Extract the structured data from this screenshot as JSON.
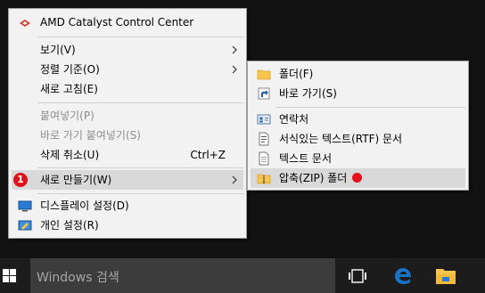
{
  "context_menu": {
    "amd": "AMD Catalyst Control Center",
    "view": "보기(V)",
    "sort": "정렬 기준(O)",
    "refresh": "새로 고침(E)",
    "paste": "붙여넣기(P)",
    "paste_shortcut": "바로 가기 붙여넣기(S)",
    "undo": "삭제 취소(U)",
    "undo_key": "Ctrl+Z",
    "new": "새로 만들기(W)",
    "new_badge": "1",
    "display": "디스플레이 설정(D)",
    "personalize": "개인 설정(R)"
  },
  "submenu": {
    "folder": "폴더(F)",
    "shortcut": "바로 가기(S)",
    "contact": "연락처",
    "rtf": "서식있는 텍스트(RTF) 문서",
    "text": "텍스트 문서",
    "zip": "압축(ZIP) 폴더"
  },
  "taskbar": {
    "search_placeholder": "Windows 검색"
  },
  "colors": {
    "highlight": "#d9d9d9",
    "badge_red": "#e0101a",
    "folder_yellow": "#f7c54a",
    "edge_blue": "#1a73c9"
  }
}
